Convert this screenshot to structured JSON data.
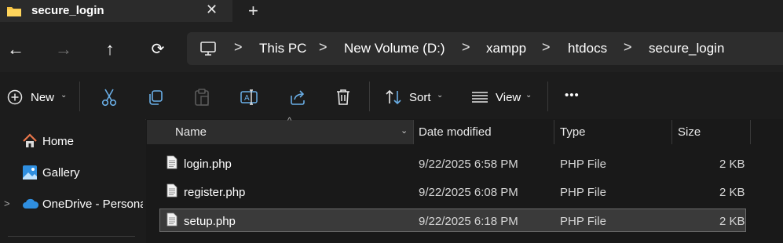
{
  "tab": {
    "title": "secure_login",
    "close": "✕",
    "new_tab": "+"
  },
  "nav": {
    "back": "←",
    "forward": "→",
    "up": "↑",
    "refresh": "⟳"
  },
  "breadcrumb": {
    "root_icon": "monitor-icon",
    "separator": ">",
    "items": [
      "This PC",
      "New Volume (D:)",
      "xampp",
      "htdocs",
      "secure_login"
    ]
  },
  "toolbar": {
    "new_label": "New",
    "sort_label": "Sort",
    "view_label": "View",
    "more": "•••",
    "chevron": "⌄"
  },
  "sidebar": {
    "expand_glyph": ">",
    "items": [
      {
        "label": "Home",
        "icon": "home-icon"
      },
      {
        "label": "Gallery",
        "icon": "gallery-icon"
      },
      {
        "label": "OneDrive - Persona",
        "icon": "cloud-icon"
      }
    ]
  },
  "columns": {
    "name": "Name",
    "date": "Date modified",
    "type": "Type",
    "size": "Size",
    "sort_glyph": "^",
    "chevron": "⌄"
  },
  "files": [
    {
      "name": "login.php",
      "date": "9/22/2025 6:58 PM",
      "type": "PHP File",
      "size": "2 KB",
      "selected": false
    },
    {
      "name": "register.php",
      "date": "9/22/2025 6:08 PM",
      "type": "PHP File",
      "size": "2 KB",
      "selected": false
    },
    {
      "name": "setup.php",
      "date": "9/22/2025 6:18 PM",
      "type": "PHP File",
      "size": "2 KB",
      "selected": true
    }
  ],
  "colors": {
    "background": "#1c1c1c",
    "tab_active": "#2b2b2b",
    "address_bar": "#2d2d2d",
    "selection": "#3a3a3a",
    "folder": "#f6c343",
    "onedrive": "#2f8fe0",
    "home_roof": "#e9764a"
  }
}
